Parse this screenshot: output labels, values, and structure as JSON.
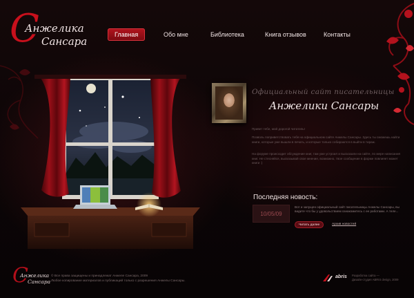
{
  "logo": {
    "line1": "Анжелика",
    "line2": "Сансара",
    "initial": "С"
  },
  "nav": {
    "items": [
      {
        "label": "Главная"
      },
      {
        "label": "Обо мне"
      },
      {
        "label": "Библиотека"
      },
      {
        "label": "Книга отзывов"
      },
      {
        "label": "Контакты"
      }
    ]
  },
  "intro": {
    "title_line1": "Официальный сайт писательницы",
    "title_line2": "Анжелики Сансары",
    "greeting": "Привет тебе, мой дорогой читатель!",
    "paragraph1": "Позволь поприветствовать тебя на официальном сайте Анжелы Сансары. Здесь ты сможешь найти книги, которые уже вышли в печать, и которые только собираются в выйти в тираж.",
    "paragraph2": "На форуме происходит обсуждение книг, там уже устроил и высказали на сайте, по мере написания книг. Не стесняйся, высказывай свое мнение, возможно, твое сообщение в форме повлияет может книги :)"
  },
  "news": {
    "heading": "Последняя новость:",
    "date": "10/05/09",
    "text": "Вот и запущен официальный сайт писательницы Анжелы Сансары, вы видите что бы у удовольствием ознакомитесь с ее работами. А теле...",
    "read_button": "Читать далее",
    "archive_link": "Архив новостей"
  },
  "footer": {
    "copyright_line1": "© Все права защищены и принадлежат Анжеле Сансара, 2009",
    "copyright_line2": "Любое копирование материалов и публикаций только с разрешения Анжелы Сансары.",
    "dev_brand": "abris",
    "dev_line1": "Разработка сайта —",
    "dev_line2": "Дизайн-студия ABRIS design, 2009"
  },
  "colors": {
    "accent": "#c8101c",
    "background": "#0a0506",
    "nav_active": "#9b0f18"
  }
}
